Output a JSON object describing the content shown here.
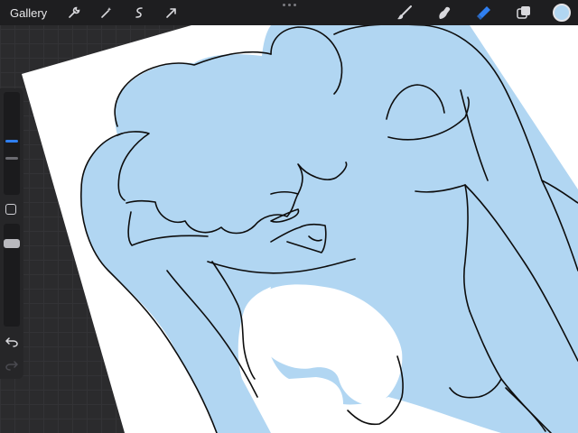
{
  "topbar": {
    "gallery_label": "Gallery",
    "left_tools": [
      "wrench-icon",
      "magic-wand-icon",
      "selection-icon",
      "transform-arrow-icon"
    ],
    "right_tools": [
      "brush-icon",
      "smudge-icon",
      "eraser-icon",
      "layers-icon"
    ],
    "active_tool": "eraser-icon",
    "current_color": "#b1d6f2"
  },
  "sidebar": {
    "brush_size": 0.52,
    "opacity": 0.84,
    "controls": [
      "brush-size-slider",
      "modify-square-icon",
      "opacity-slider",
      "undo-icon",
      "redo-icon"
    ]
  },
  "canvas": {
    "paper_color": "#ffffff",
    "fill_color": "#b1d6f2",
    "line_color": "#0d0d0d"
  },
  "colors": {
    "toolbar_bg": "#1e1e20",
    "sidebar_bg": "#262628",
    "accent": "#2f7ff0",
    "icon": "#d8d8dc"
  }
}
